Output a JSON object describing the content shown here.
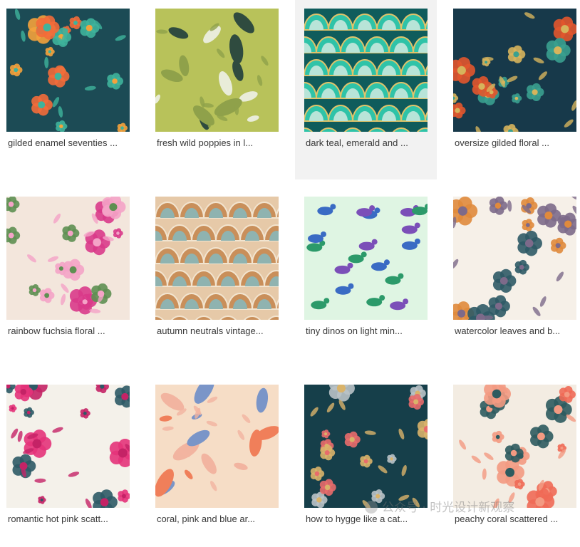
{
  "grid": {
    "items": [
      {
        "caption": "gilded enamel seventies ...",
        "palette": {
          "bg": "#1c4b55",
          "a": "#f26b3a",
          "b": "#f4a23c",
          "c": "#3fb39b"
        }
      },
      {
        "caption": "fresh wild poppies in l...",
        "palette": {
          "bg": "#b8c25a",
          "a": "#2f4b3f",
          "b": "#e9ecd9",
          "c": "#8fa14a"
        }
      },
      {
        "caption": "dark teal, emerald and ...",
        "palette": {
          "bg": "#0f5c5c",
          "a": "#2fc3a8",
          "b": "#b8e4d8",
          "c": "#e0c36a"
        }
      },
      {
        "caption": "oversize gilded floral ...",
        "palette": {
          "bg": "#17394a",
          "a": "#e2572e",
          "b": "#3aa08f",
          "c": "#d6b45c"
        }
      },
      {
        "caption": "rainbow fuchsia floral ...",
        "palette": {
          "bg": "#f3e6dc",
          "a": "#d93a8a",
          "b": "#5e8f52",
          "c": "#f4a3c7"
        }
      },
      {
        "caption": "autumn neutrals vintage...",
        "palette": {
          "bg": "#e6c9a8",
          "a": "#c98f5a",
          "b": "#8fb3b0",
          "c": "#f2e4cf"
        }
      },
      {
        "caption": "tiny dinos on light min...",
        "palette": {
          "bg": "#dff5e3",
          "a": "#2c9a6a",
          "b": "#3a6bc4",
          "c": "#7b4fb8"
        }
      },
      {
        "caption": "watercolor leaves and b...",
        "palette": {
          "bg": "#f6f0e8",
          "a": "#2f5a66",
          "b": "#e08a3c",
          "c": "#7d6a8a"
        }
      },
      {
        "caption": "romantic hot pink scatt...",
        "palette": {
          "bg": "#f4f1ea",
          "a": "#e4337a",
          "b": "#2d5a66",
          "c": "#c42366"
        }
      },
      {
        "caption": "coral, pink and blue ar...",
        "palette": {
          "bg": "#f6ddc6",
          "a": "#f07f5a",
          "b": "#7a95c8",
          "c": "#f2b4a0"
        }
      },
      {
        "caption": "how to hygge like a cat...",
        "palette": {
          "bg": "#163f4a",
          "a": "#b9c2c6",
          "b": "#e86c6c",
          "c": "#d9b36a"
        }
      },
      {
        "caption": "peachy coral scattered ...",
        "palette": {
          "bg": "#f3ece2",
          "a": "#ef6a56",
          "b": "#2e5b5f",
          "c": "#f39a82"
        }
      }
    ]
  },
  "watermark": {
    "text": "公众号 · 时光设计新观察"
  }
}
